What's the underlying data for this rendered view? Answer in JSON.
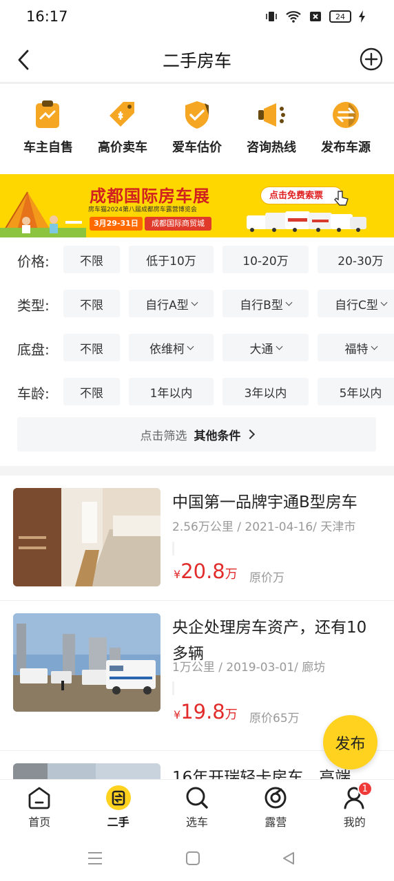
{
  "status_bar": {
    "time": "16:17",
    "battery": "24"
  },
  "header": {
    "title": "二手房车"
  },
  "quick_actions": [
    {
      "label": "车主自售",
      "icon": "clipboard-chart-icon"
    },
    {
      "label": "高价卖车",
      "icon": "price-tag-icon"
    },
    {
      "label": "爱车估价",
      "icon": "shield-check-icon"
    },
    {
      "label": "咨询热线",
      "icon": "megaphone-icon"
    },
    {
      "label": "发布车源",
      "icon": "exchange-icon"
    }
  ],
  "banner": {
    "title": "成都国际房车展",
    "subtitle": "房车猫2024第八届成都房车露营博览会",
    "date": "3月29-31日",
    "venue": "成都国际商贸城",
    "cta": "点击免费索票"
  },
  "filters": [
    {
      "label": "价格:",
      "options": [
        "不限",
        "低于10万",
        "10-20万",
        "20-30万"
      ],
      "dropdowns": [
        false,
        false,
        false,
        false
      ]
    },
    {
      "label": "类型:",
      "options": [
        "不限",
        "自行A型",
        "自行B型",
        "自行C型"
      ],
      "dropdowns": [
        false,
        true,
        true,
        true
      ]
    },
    {
      "label": "底盘:",
      "options": [
        "不限",
        "依维柯",
        "大通",
        "福特"
      ],
      "dropdowns": [
        false,
        true,
        true,
        true
      ]
    },
    {
      "label": "车龄:",
      "options": [
        "不限",
        "1年以内",
        "3年以内",
        "5年以内"
      ],
      "dropdowns": [
        false,
        false,
        false,
        false
      ]
    }
  ],
  "more_filters": {
    "hint": "点击筛选",
    "label": "其他条件"
  },
  "listings": [
    {
      "title": "中国第一品牌宇通B型房车",
      "meta": "2.56万公里 / 2021-04-16/ 天津市",
      "currency": "¥",
      "price": "20.8",
      "unit": "万",
      "original": "原价万"
    },
    {
      "title": "央企处理房车资产，还有10多辆",
      "meta": "1万公里 / 2019-03-01/ 廊坊",
      "currency": "¥",
      "price": "19.8",
      "unit": "万",
      "original": "原价65万"
    },
    {
      "title": "16年开瑞轻卡房车，高端",
      "meta": "",
      "currency": "",
      "price": "",
      "unit": "",
      "original": ""
    }
  ],
  "fab": {
    "label": "发布"
  },
  "bottom_nav": [
    {
      "label": "首页",
      "icon": "home-icon"
    },
    {
      "label": "二手",
      "icon": "secondhand-icon",
      "active": true
    },
    {
      "label": "选车",
      "icon": "search-icon"
    },
    {
      "label": "露营",
      "icon": "camp-icon"
    },
    {
      "label": "我的",
      "icon": "profile-icon",
      "badge": "1"
    }
  ],
  "colors": {
    "accent": "#ffd21f",
    "price": "#e22b2b",
    "icon_orange": "#f5a623"
  }
}
